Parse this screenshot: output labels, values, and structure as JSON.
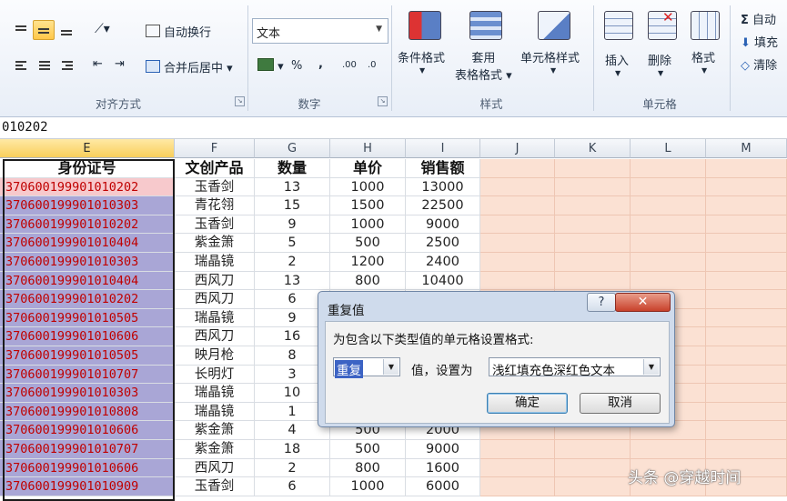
{
  "ribbon": {
    "alignment": {
      "group_label": "对齐方式",
      "wrap_text": "自动换行",
      "merge_center": "合并后居中"
    },
    "number": {
      "group_label": "数字",
      "format_value": "文本",
      "percent": "%",
      "comma": ",",
      "inc_decimal": ".00",
      "dec_decimal": ".0"
    },
    "styles": {
      "group_label": "样式",
      "conditional_format": "条件格式",
      "table_format_line1": "套用",
      "table_format_line2": "表格格式",
      "cell_styles": "单元格样式"
    },
    "cells": {
      "group_label": "单元格",
      "insert": "插入",
      "delete": "删除",
      "format": "格式"
    },
    "editing": {
      "autosum": "自动",
      "fill": "填充",
      "clear": "清除"
    }
  },
  "formula_bar": {
    "value": "010202"
  },
  "grid": {
    "columns": [
      "E",
      "F",
      "G",
      "H",
      "I",
      "J",
      "K",
      "L",
      "M"
    ],
    "headers": [
      "身份证号",
      "文创产品",
      "数量",
      "单价",
      "销售额"
    ],
    "rows": [
      [
        "370600199901010202",
        "玉香剑",
        "13",
        "1000",
        "13000"
      ],
      [
        "370600199901010303",
        "青花翎",
        "15",
        "1500",
        "22500"
      ],
      [
        "370600199901010202",
        "玉香剑",
        "9",
        "1000",
        "9000"
      ],
      [
        "370600199901010404",
        "紫金箫",
        "5",
        "500",
        "2500"
      ],
      [
        "370600199901010303",
        "瑞晶镜",
        "2",
        "1200",
        "2400"
      ],
      [
        "370600199901010404",
        "西风刀",
        "13",
        "800",
        "10400"
      ],
      [
        "370600199901010202",
        "西风刀",
        "6",
        "",
        ""
      ],
      [
        "370600199901010505",
        "瑞晶镜",
        "9",
        "",
        ""
      ],
      [
        "370600199901010606",
        "西风刀",
        "16",
        "",
        ""
      ],
      [
        "370600199901010505",
        "映月枪",
        "8",
        "",
        ""
      ],
      [
        "370600199901010707",
        "长明灯",
        "3",
        "",
        ""
      ],
      [
        "370600199901010303",
        "瑞晶镜",
        "10",
        "",
        ""
      ],
      [
        "370600199901010808",
        "瑞晶镜",
        "1",
        "",
        ""
      ],
      [
        "370600199901010606",
        "紫金箫",
        "4",
        "500",
        "2000"
      ],
      [
        "370600199901010707",
        "紫金箫",
        "18",
        "500",
        "9000"
      ],
      [
        "370600199901010606",
        "西风刀",
        "2",
        "800",
        "1600"
      ],
      [
        "370600199901010909",
        "玉香剑",
        "6",
        "1000",
        "6000"
      ]
    ]
  },
  "dialog": {
    "title": "重复值",
    "help": "?",
    "close": "✕",
    "prompt": "为包含以下类型值的单元格设置格式:",
    "type_value": "重复",
    "middle_text": "值，设置为",
    "format_value": "浅红填充色深红色文本",
    "ok": "确定",
    "cancel": "取消"
  },
  "watermark": "头条 @穿越时间",
  "colors": {
    "duplicate_fill": "#a9a6d6",
    "highlight_fill": "#f7c9cc",
    "duplicate_text": "#c00000",
    "peach_fill": "#fbe1d3"
  }
}
